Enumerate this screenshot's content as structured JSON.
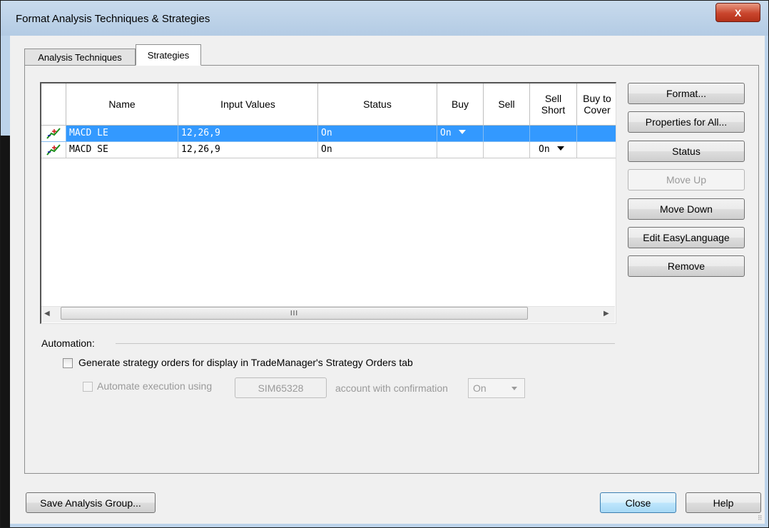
{
  "window": {
    "title": "Format Analysis Techniques & Strategies",
    "close_glyph": "X"
  },
  "tabs": [
    {
      "label": "Analysis Techniques",
      "active": false
    },
    {
      "label": "Strategies",
      "active": true
    }
  ],
  "table": {
    "columns": [
      "",
      "Name",
      "Input Values",
      "Status",
      "Buy",
      "Sell",
      "Sell\nShort",
      "Buy to\nCover"
    ],
    "rows": [
      {
        "icon": "strategy-chart-icon",
        "name": "MACD LE",
        "inputs": "12,26,9",
        "status": "On",
        "buy": "On",
        "sell": "",
        "sell_short": "",
        "buy_to_cover": "",
        "selected": true
      },
      {
        "icon": "strategy-chart-icon",
        "name": "MACD SE",
        "inputs": "12,26,9",
        "status": "On",
        "buy": "",
        "sell": "",
        "sell_short": "On",
        "buy_to_cover": "",
        "selected": false
      }
    ],
    "scrollbar_thumb_glyph": "III"
  },
  "side_buttons": {
    "format": "Format...",
    "properties_for_all": "Properties for All...",
    "status": "Status",
    "move_up": "Move Up",
    "move_down": "Move Down",
    "edit_easylanguage": "Edit EasyLanguage",
    "remove": "Remove"
  },
  "automation": {
    "label": "Automation:",
    "generate_orders_label": "Generate strategy orders for display in TradeManager's Strategy Orders tab",
    "generate_orders_checked": false,
    "automate_label": "Automate execution using",
    "automate_checked": false,
    "account": "SIM65328",
    "confirmation_label": "account with confirmation",
    "confirmation_value": "On"
  },
  "footer": {
    "save_group": "Save Analysis Group...",
    "close": "Close",
    "help": "Help"
  },
  "colors": {
    "selection": "#3399ff",
    "titlebar": "#bcd3ea",
    "close_button": "#c9452d"
  }
}
